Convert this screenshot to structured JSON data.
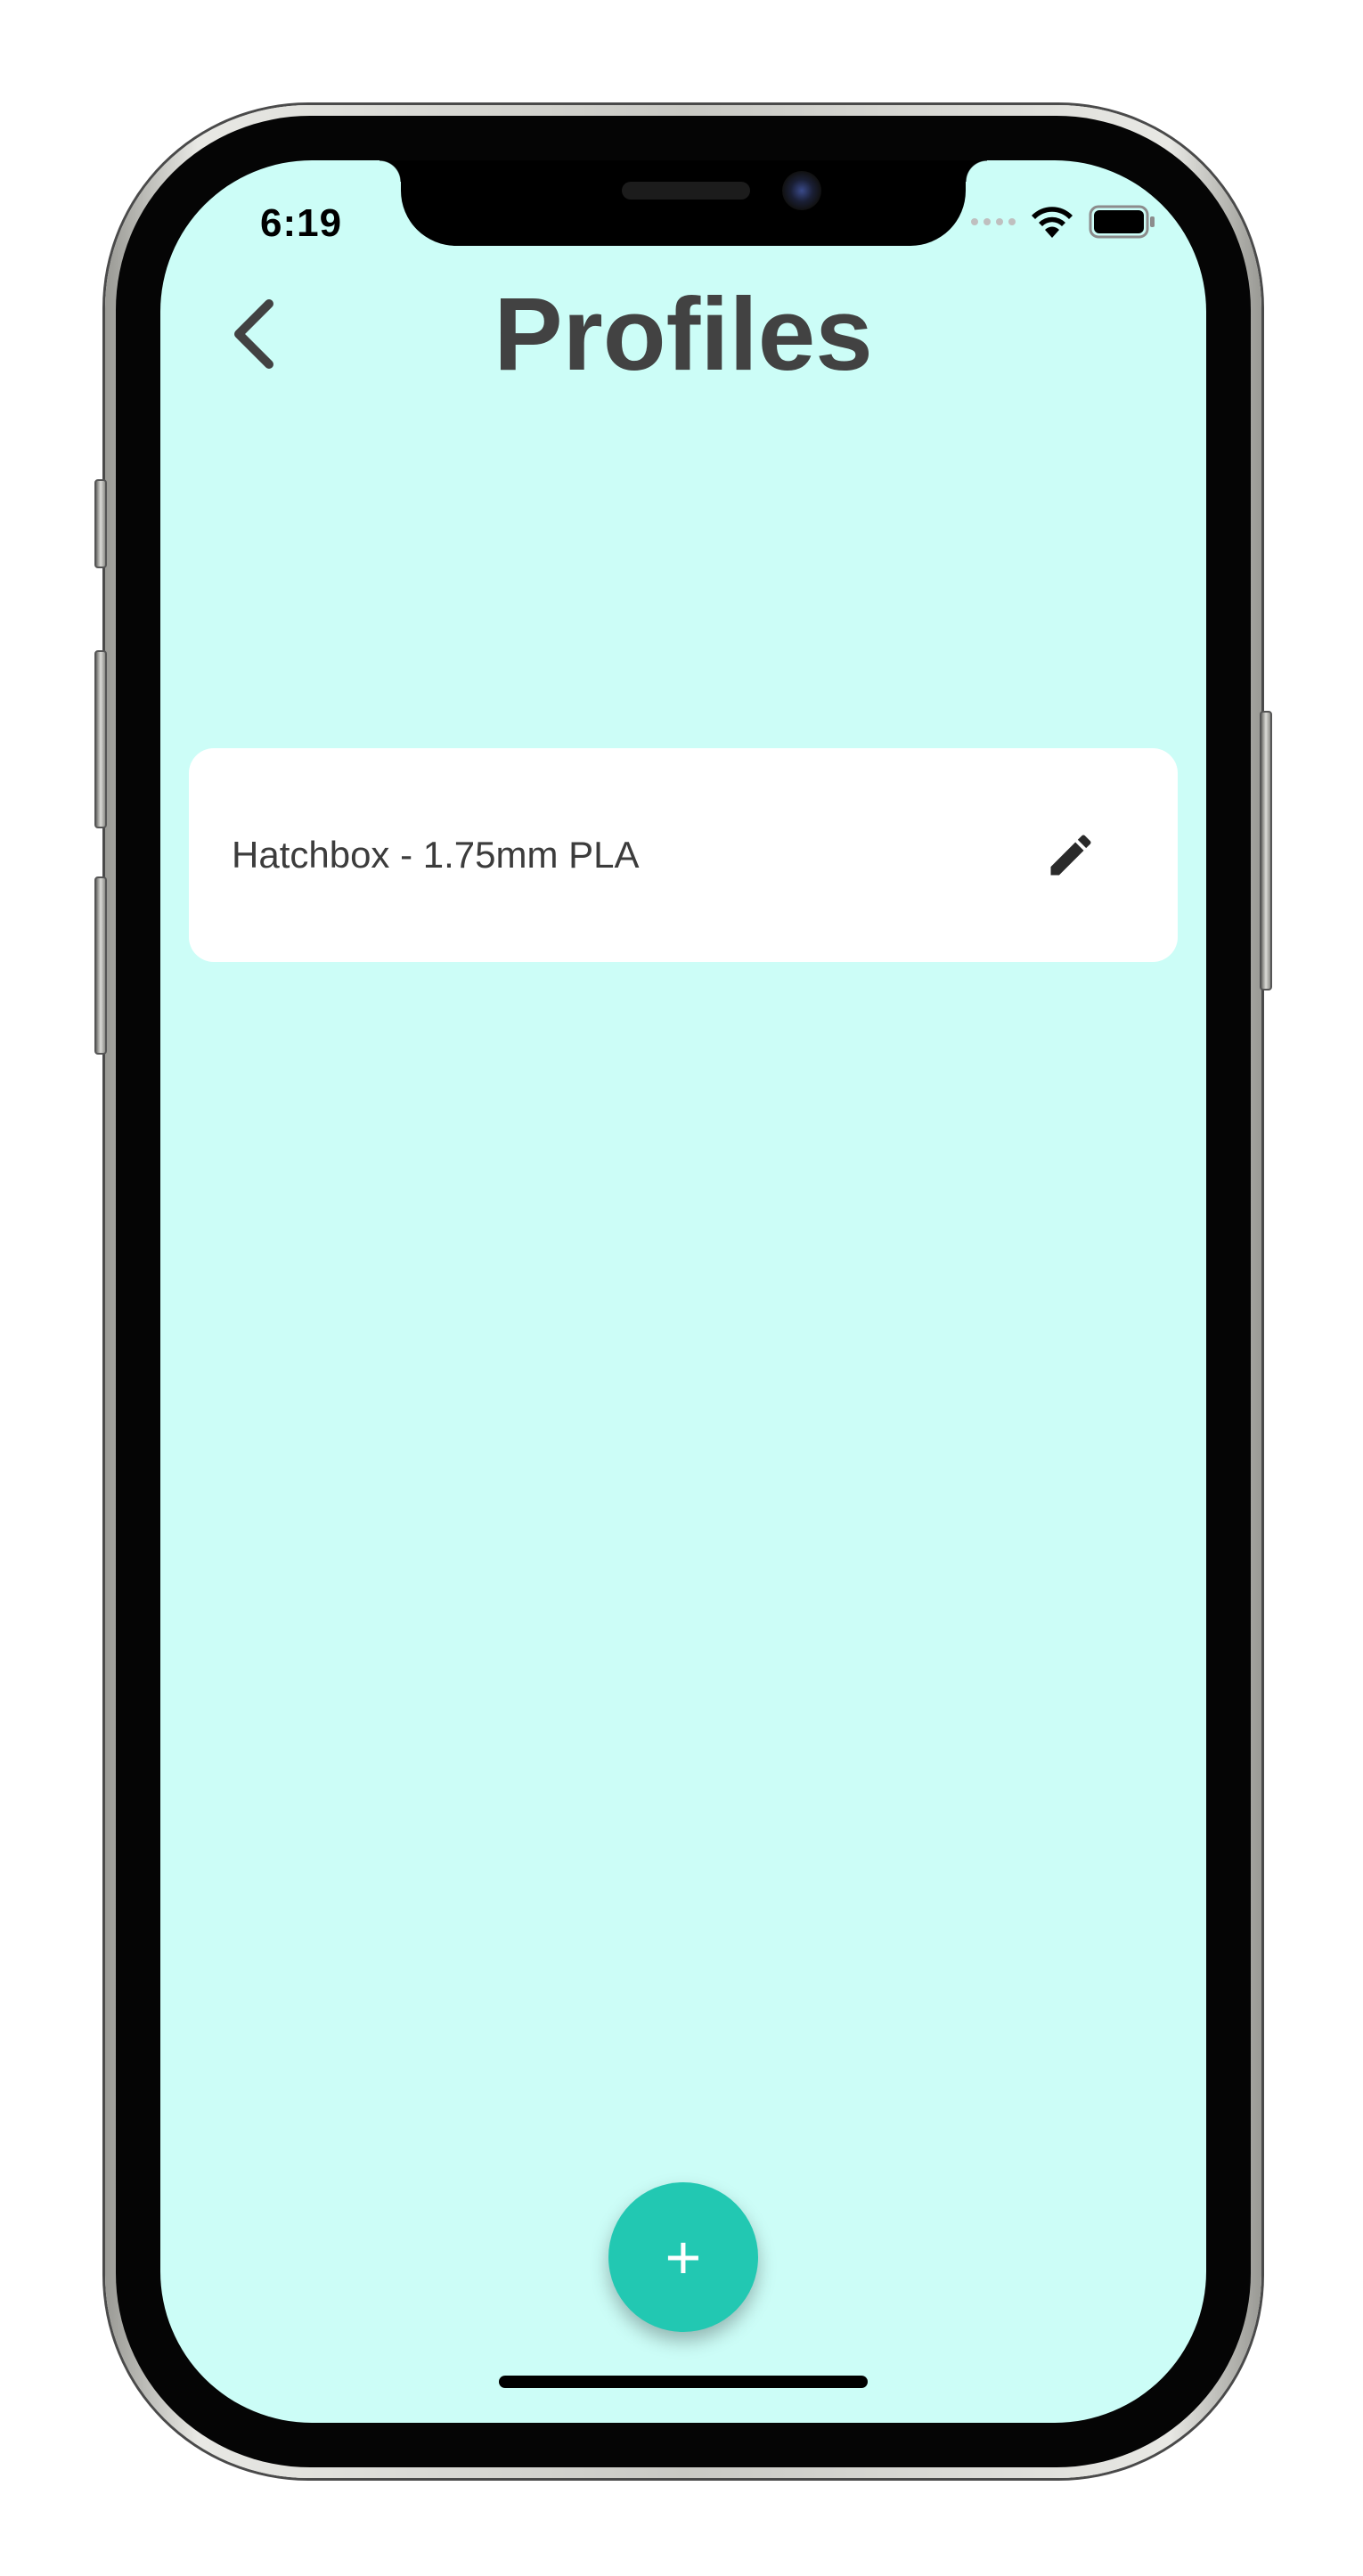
{
  "status_bar": {
    "time": "6:19",
    "icons": [
      "signal-dots-icon",
      "wifi-icon",
      "battery-icon"
    ]
  },
  "header": {
    "title": "Profiles",
    "back_icon": "chevron-left-icon"
  },
  "profiles": [
    {
      "name": "Hatchbox - 1.75mm PLA",
      "action_icon": "pencil-edit-icon"
    }
  ],
  "fab": {
    "label": "+",
    "icon": "plus-icon"
  },
  "colors": {
    "background": "#ccfdf7",
    "card": "#ffffff",
    "title_text": "#424242",
    "accent": "#22c8b2"
  }
}
